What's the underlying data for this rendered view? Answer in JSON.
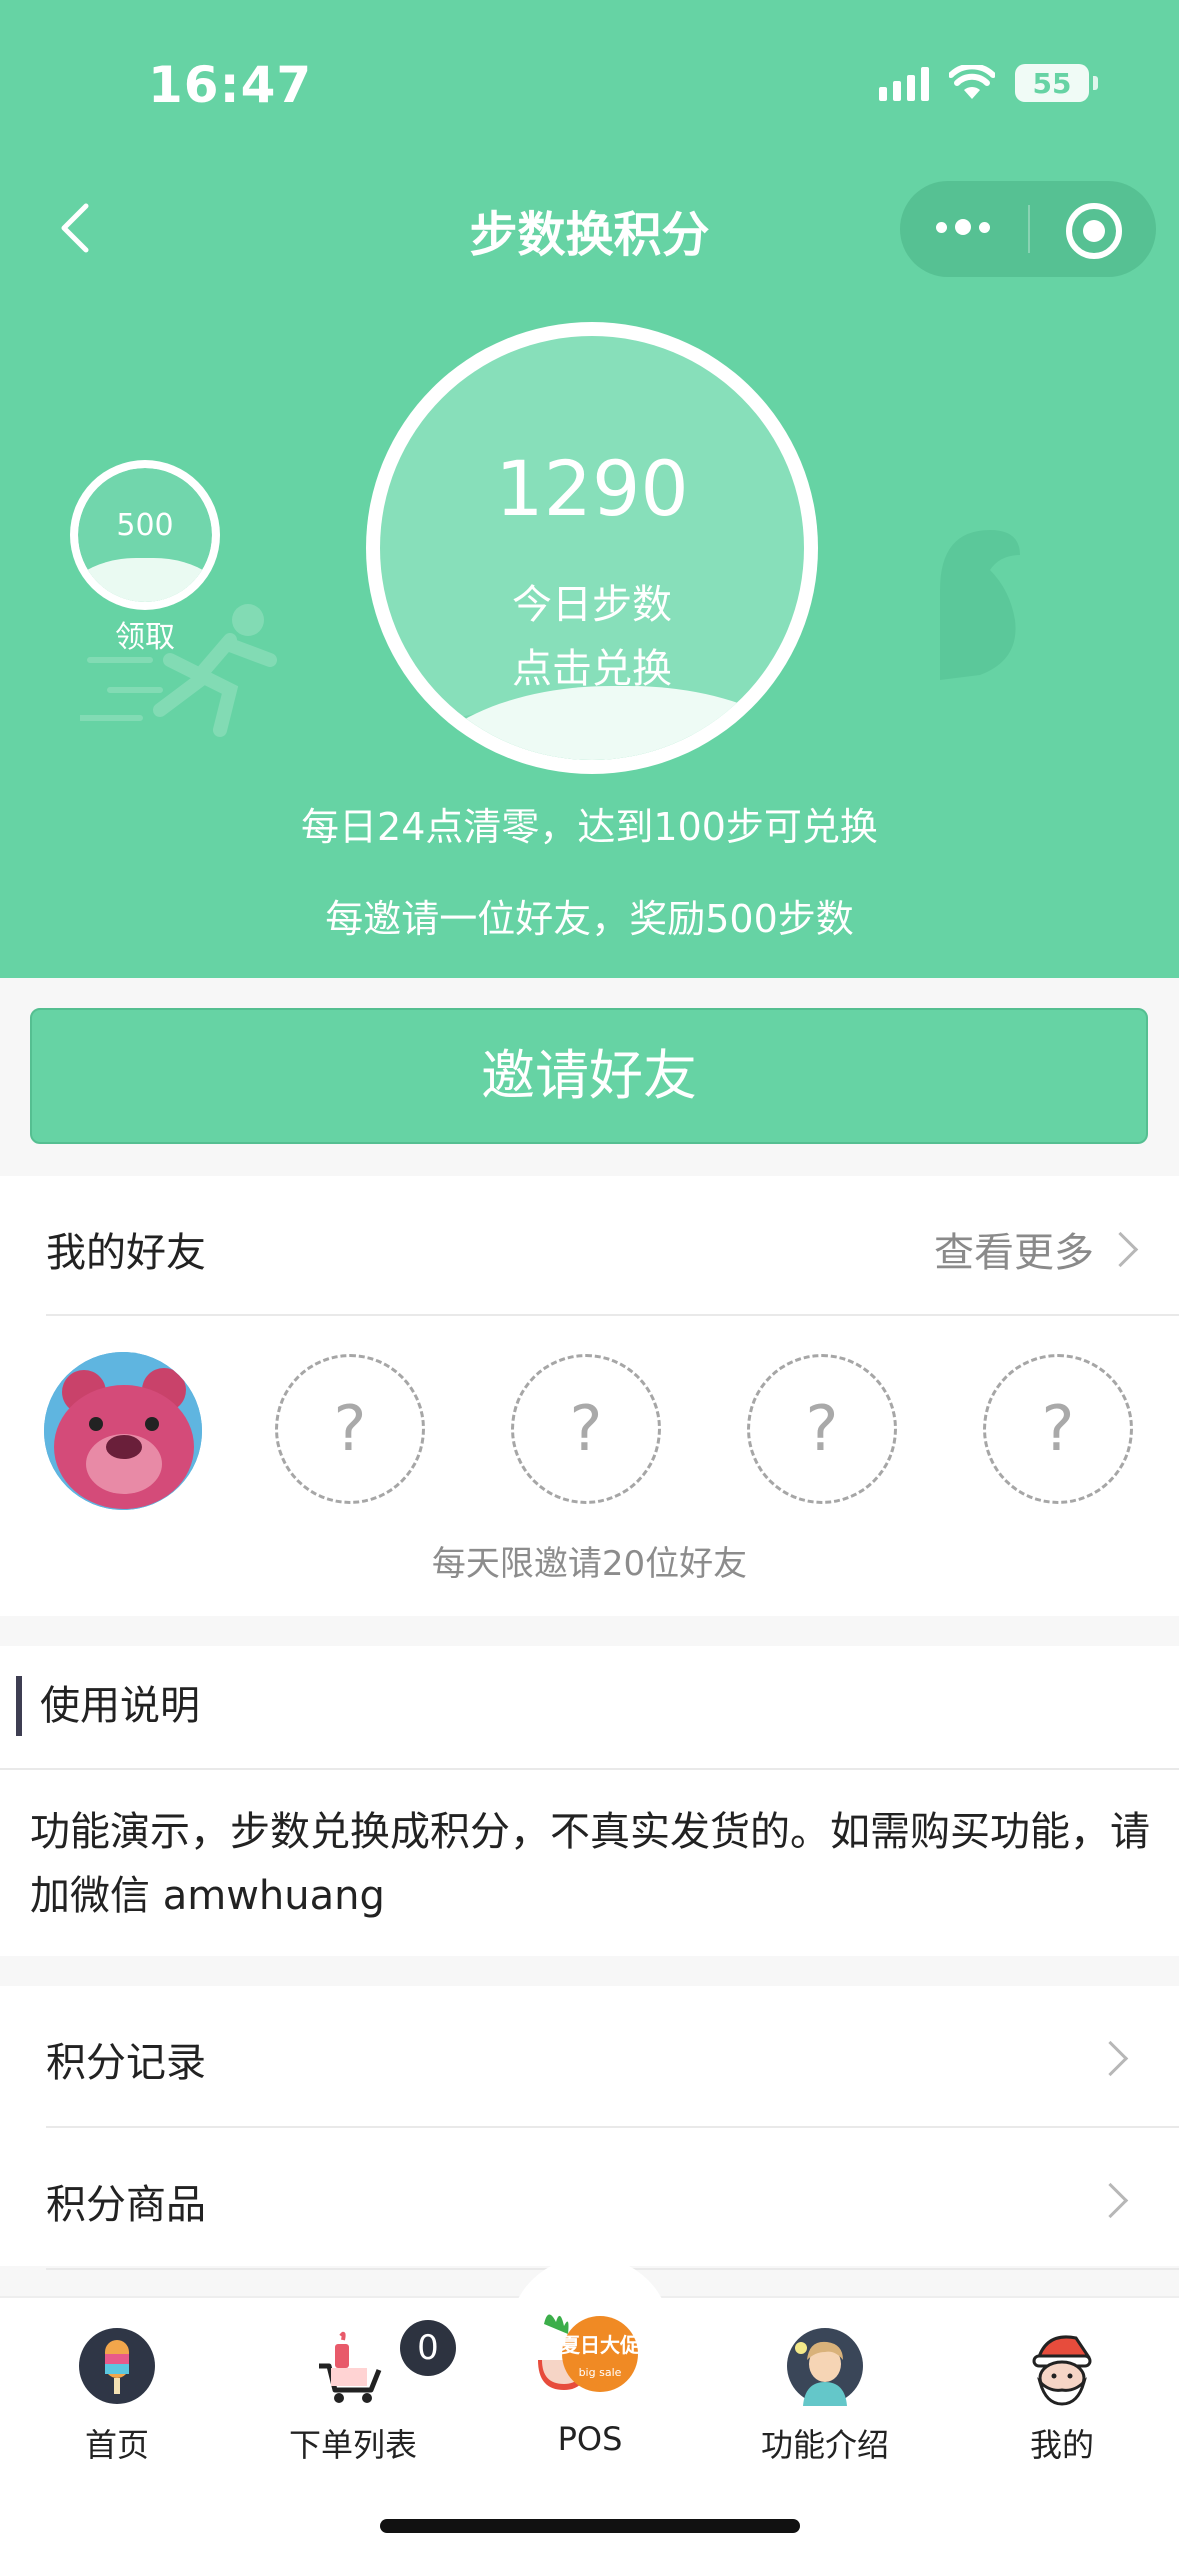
{
  "status_bar": {
    "time": "16:47",
    "battery": "55"
  },
  "nav": {
    "title": "步数换积分"
  },
  "bonus_bubble": {
    "value": "500",
    "label": "领取"
  },
  "steps": {
    "value": "1290",
    "label": "今日步数",
    "action": "点击兑换"
  },
  "notes": [
    "每日24点清零，达到100步可兑换",
    "每邀请一位好友，奖励500步数"
  ],
  "invite_button": "邀请好友",
  "friends": {
    "title": "我的好友",
    "more": "查看更多",
    "slots": [
      "?",
      "?",
      "?",
      "?"
    ],
    "limit_text": "每天限邀请20位好友"
  },
  "instructions": {
    "title": "使用说明",
    "body": "功能演示，步数兑换成积分，不真实发货的。如需购买功能，请加微信 amwhuang"
  },
  "menu": [
    {
      "label": "积分记录"
    },
    {
      "label": "积分商品"
    }
  ],
  "tabbar": {
    "items": [
      {
        "label": "首页",
        "icon": "popsicle-icon"
      },
      {
        "label": "下单列表",
        "icon": "cart-icon",
        "badge": "0"
      },
      {
        "label": "POS",
        "icon": "summer-promo-icon",
        "icon_text": "夏日大促"
      },
      {
        "label": "功能介绍",
        "icon": "person-icon"
      },
      {
        "label": "我的",
        "icon": "santa-icon"
      }
    ]
  },
  "colors": {
    "accent": "#66d3a4",
    "text": "#222222",
    "muted": "#8a8a8a",
    "background": "#f7f7f7"
  }
}
